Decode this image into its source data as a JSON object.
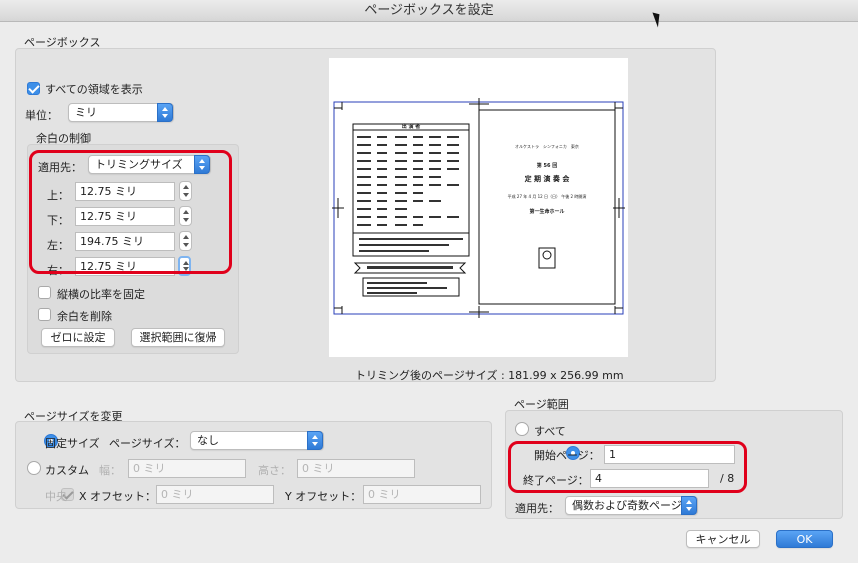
{
  "window": {
    "title": "ページボックスを設定"
  },
  "page_box": {
    "section_label": "ページボックス",
    "show_all": {
      "label": "すべての領域を表示",
      "checked": true
    },
    "unit": {
      "label": "単位：",
      "value": "ミリ"
    },
    "margins": {
      "section_label": "余白の制御",
      "apply_to": {
        "label": "適用先：",
        "value": "トリミングサイズ"
      },
      "top": {
        "label": "上：",
        "value": "12.75 ミリ"
      },
      "bottom": {
        "label": "下：",
        "value": "12.75 ミリ"
      },
      "left": {
        "label": "左：",
        "value": "194.75 ミリ"
      },
      "right": {
        "label": "右：",
        "value": "12.75 ミリ"
      },
      "constrain": {
        "label": "縦横の比率を固定",
        "checked": false
      },
      "remove_white": {
        "label": "余白を削除",
        "checked": false
      },
      "set_zero": "ゼロに設定",
      "revert": "選択範囲に復帰"
    },
    "crop_size": "トリミング後のページサイズ : 181.99 x 256.99 mm",
    "preview": {
      "header": "出 演 者",
      "right_title_small": "オルケストラ　シンフォニカ　東京",
      "edition": "第 56 回",
      "concert": "定 期 演 奏 会",
      "date": "平成 27 年 4 月 12 日（日） 午後 2 時開演",
      "venue": "第一生命ホール"
    }
  },
  "page_size": {
    "section_label": "ページサイズを変更",
    "fixed": {
      "label": "固定サイズ",
      "selected": true
    },
    "size_label": "ページサイズ：",
    "size_value": "なし",
    "custom": {
      "label": "カスタム",
      "selected": false
    },
    "width": {
      "label": "幅：",
      "placeholder": "0 ミリ"
    },
    "height": {
      "label": "高さ：",
      "placeholder": "0 ミリ"
    },
    "center": {
      "label": "中央",
      "checked": true
    },
    "x_offset": {
      "label": "X オフセット：",
      "placeholder": "0 ミリ"
    },
    "y_offset": {
      "label": "Y オフセット：",
      "placeholder": "0 ミリ"
    }
  },
  "page_range": {
    "section_label": "ページ範囲",
    "all": {
      "label": "すべて",
      "selected": false
    },
    "start": {
      "label": "開始ページ：",
      "value": "1",
      "selected": true
    },
    "end": {
      "label": "終了ページ：",
      "value": "4"
    },
    "total": "/ 8",
    "apply_to": {
      "label": "適用先：",
      "value": "偶数および奇数ページ"
    }
  },
  "buttons": {
    "cancel": "キャンセル",
    "ok": "OK"
  },
  "colors": {
    "accent": "#3d8fe8",
    "highlight": "#e0001b",
    "trim": "#2a3fb8"
  }
}
